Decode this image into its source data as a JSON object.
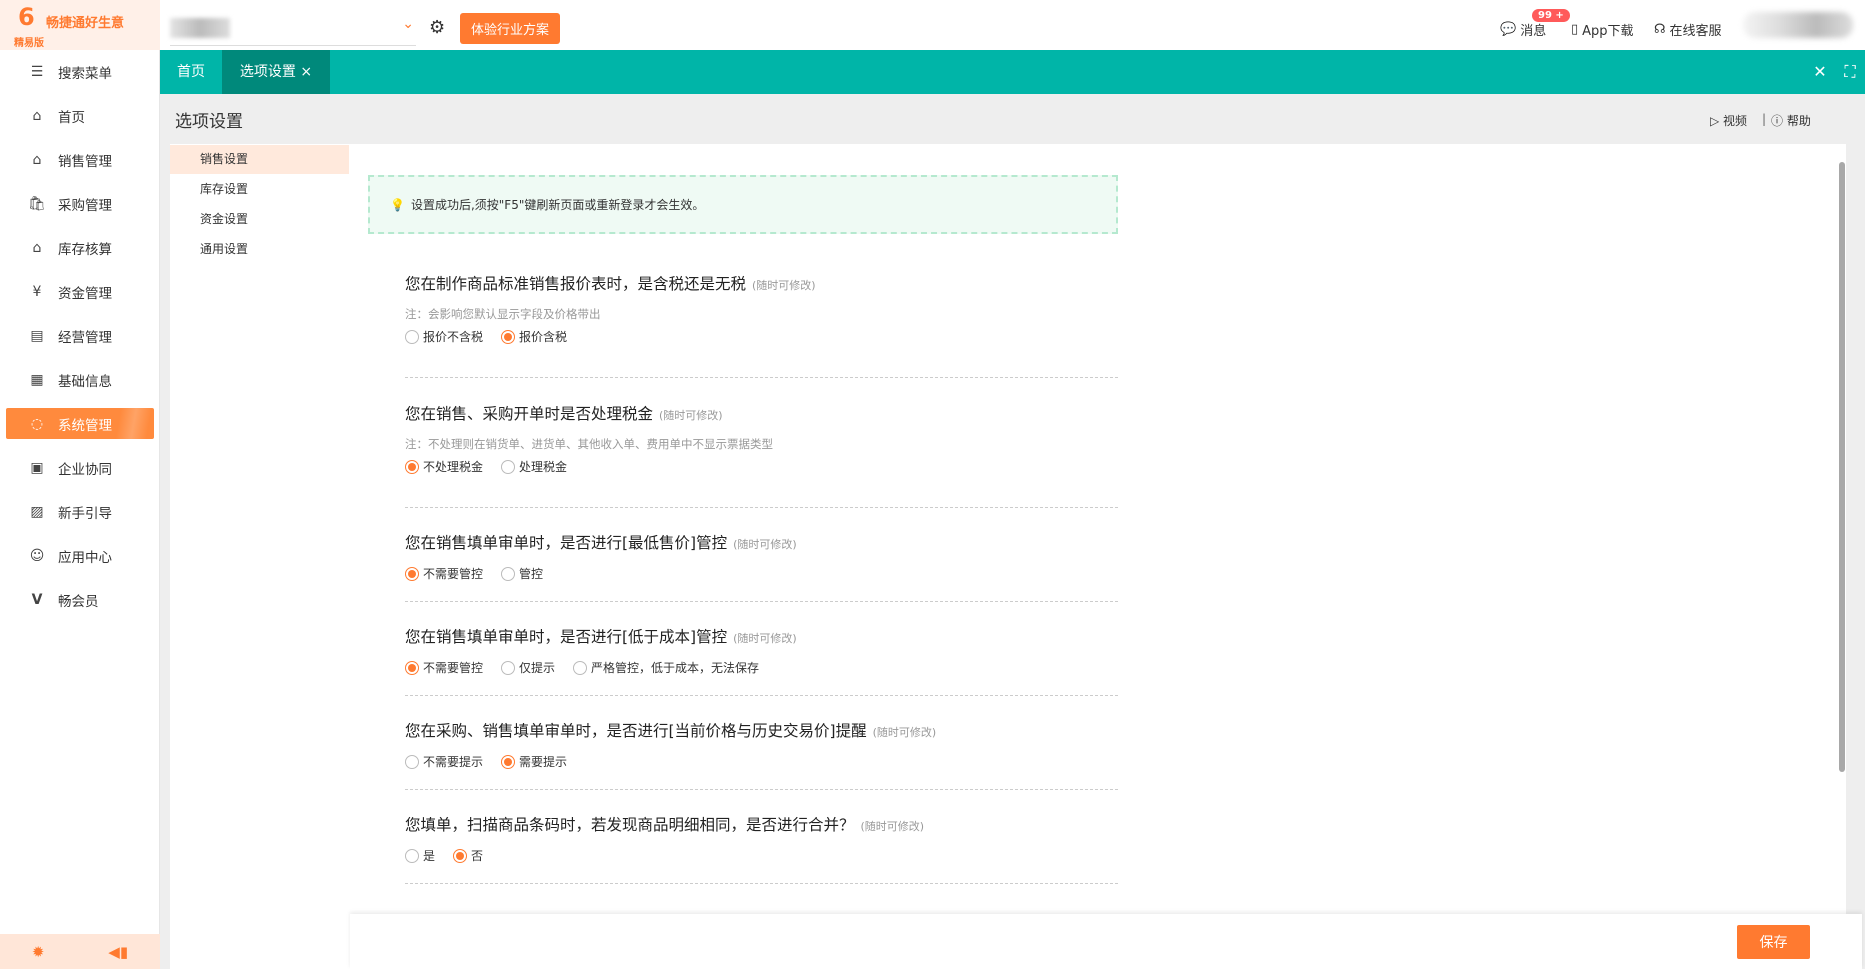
{
  "app": {
    "name": "畅捷通好生意",
    "edition": "精易版"
  },
  "topbar": {
    "trial_button": "体验行业方案",
    "messages": "消息",
    "messages_badge": "99 +",
    "app_download": "App下载",
    "support": "在线客服"
  },
  "tabs": [
    {
      "label": "首页"
    },
    {
      "label": "选项设置",
      "closable": true
    }
  ],
  "sidebar": {
    "items": [
      {
        "label": "搜索菜单",
        "icon": "search-menu-icon"
      },
      {
        "label": "首页",
        "icon": "home-icon"
      },
      {
        "label": "销售管理",
        "icon": "sales-icon"
      },
      {
        "label": "采购管理",
        "icon": "purchase-icon"
      },
      {
        "label": "库存核算",
        "icon": "inventory-icon"
      },
      {
        "label": "资金管理",
        "icon": "money-icon"
      },
      {
        "label": "经营管理",
        "icon": "clipboard-icon"
      },
      {
        "label": "基础信息",
        "icon": "info-icon"
      },
      {
        "label": "系统管理",
        "icon": "system-icon",
        "active": true
      },
      {
        "label": "企业协同",
        "icon": "collab-icon"
      },
      {
        "label": "新手引导",
        "icon": "guide-icon"
      },
      {
        "label": "应用中心",
        "icon": "app-center-icon"
      },
      {
        "label": "畅会员",
        "icon": "vip-icon"
      }
    ]
  },
  "page": {
    "title": "选项设置",
    "video": "视频",
    "help": "帮助"
  },
  "subnav": [
    {
      "label": "销售设置",
      "active": true
    },
    {
      "label": "库存设置"
    },
    {
      "label": "资金设置"
    },
    {
      "label": "通用设置"
    }
  ],
  "notice": "设置成功后,须按\"F5\"键刷新页面或重新登录才会生效。",
  "questions": [
    {
      "title": "您在制作商品标准销售报价表时，是含税还是无税",
      "hint": "(随时可修改)",
      "note": "注：会影响您默认显示字段及价格带出",
      "options": [
        "报价不含税",
        "报价含税"
      ],
      "selected": 1
    },
    {
      "title": "您在销售、采购开单时是否处理税金",
      "hint": "(随时可修改)",
      "note": "注：不处理则在销货单、进货单、其他收入单、费用单中不显示票据类型",
      "options": [
        "不处理税金",
        "处理税金"
      ],
      "selected": 0
    },
    {
      "title": "您在销售填单审单时，是否进行[最低售价]管控",
      "hint": "(随时可修改)",
      "options": [
        "不需要管控",
        "管控"
      ],
      "selected": 0
    },
    {
      "title": "您在销售填单审单时，是否进行[低于成本]管控",
      "hint": "(随时可修改)",
      "options": [
        "不需要管控",
        "仅提示",
        "严格管控，低于成本，无法保存"
      ],
      "selected": 0
    },
    {
      "title": "您在采购、销售填单审单时，是否进行[当前价格与历史交易价]提醒",
      "hint": "(随时可修改)",
      "options": [
        "不需要提示",
        "需要提示"
      ],
      "selected": 1
    },
    {
      "title": "您填单，扫描商品条码时，若发现商品明细相同，是否进行合并？",
      "hint": "(随时可修改)",
      "options": [
        "是",
        "否"
      ],
      "selected": 1
    }
  ],
  "footer": {
    "save": "保存"
  },
  "colors": {
    "accent": "#ff7a30",
    "teal": "#00b5a8",
    "teal_active": "#00897b"
  }
}
